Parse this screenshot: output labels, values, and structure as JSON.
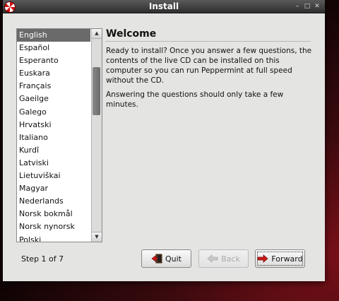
{
  "window": {
    "title": "Install",
    "controls": {
      "minimize": "–",
      "maximize": "□",
      "close": "✕"
    }
  },
  "language_list": {
    "selected": "English",
    "items": [
      "English",
      "Español",
      "Esperanto",
      "Euskara",
      "Français",
      "Gaeilge",
      "Galego",
      "Hrvatski",
      "Italiano",
      "Kurdî",
      "Latviski",
      "Lietuviškai",
      "Magyar",
      "Nederlands",
      "Norsk bokmål",
      "Norsk nynorsk",
      "Polski"
    ]
  },
  "content": {
    "title": "Welcome",
    "paragraph_1": [
      "Ready to install?  Once you answer a few questions, the",
      "contents of the live CD can be installed on this",
      "computer so you can run Peppermint at full speed",
      "without the CD."
    ],
    "paragraph_2": "Answering the questions should only take a few minutes."
  },
  "footer": {
    "step_text": "Step 1 of 7",
    "buttons": {
      "quit": "Quit",
      "back": "Back",
      "forward": "Forward"
    }
  },
  "icons": {
    "app": "peppermint-icon",
    "quit": "exit-door-icon",
    "back": "arrow-left-icon",
    "forward": "arrow-right-icon"
  },
  "colors": {
    "titlebar": "#3c3c3c",
    "selection": "#6a6a6a",
    "window_bg": "#e4e4e2",
    "accent_red": "#cc1818"
  }
}
